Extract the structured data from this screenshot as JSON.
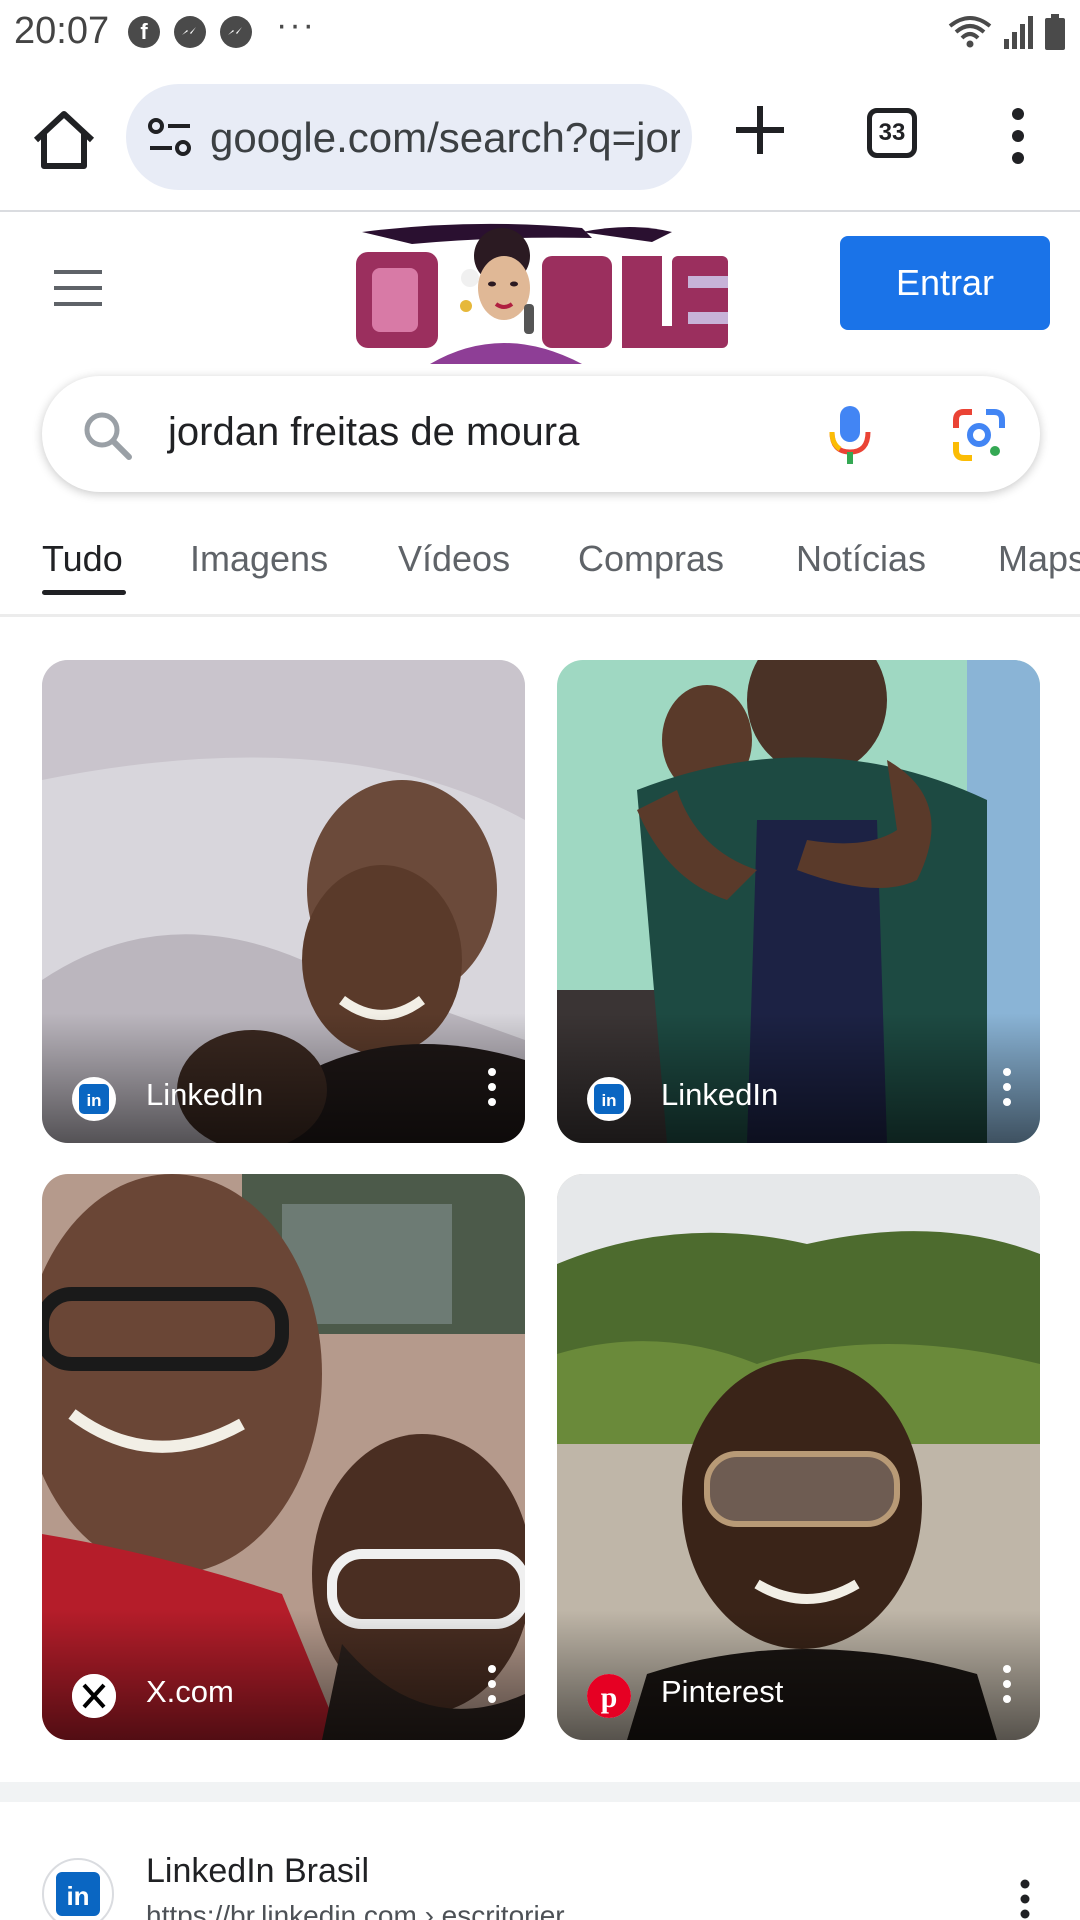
{
  "status_bar": {
    "time": "20:07",
    "left_icons": [
      "facebook-icon",
      "messenger-icon",
      "messenger-icon",
      "more-notifications-icon"
    ],
    "right_icons": [
      "wifi-icon",
      "signal-icon",
      "battery-icon"
    ]
  },
  "browser": {
    "url": "google.com/search?q=jordan+freitas+de+moura",
    "tab_count": "33"
  },
  "header": {
    "login_label": "Entrar"
  },
  "search": {
    "query": "jordan freitas de moura"
  },
  "tabs": [
    {
      "label": "Tudo",
      "active": true
    },
    {
      "label": "Imagens",
      "active": false
    },
    {
      "label": "Vídeos",
      "active": false
    },
    {
      "label": "Compras",
      "active": false
    },
    {
      "label": "Notícias",
      "active": false
    },
    {
      "label": "Maps",
      "active": false
    }
  ],
  "image_results": [
    {
      "source": "LinkedIn",
      "icon": "linkedin-icon"
    },
    {
      "source": "LinkedIn",
      "icon": "linkedin-icon"
    },
    {
      "source": "X.com",
      "icon": "x-icon"
    },
    {
      "source": "Pinterest",
      "icon": "pinterest-icon"
    }
  ],
  "result": {
    "title": "LinkedIn Brasil",
    "url": "https://br.linkedin.com › escritorier",
    "icon": "linkedin-icon"
  },
  "colors": {
    "accent": "#1a73e8",
    "url_pill": "#e8ecf6",
    "linkedin": "#0a66c2",
    "pinterest": "#e60023"
  }
}
